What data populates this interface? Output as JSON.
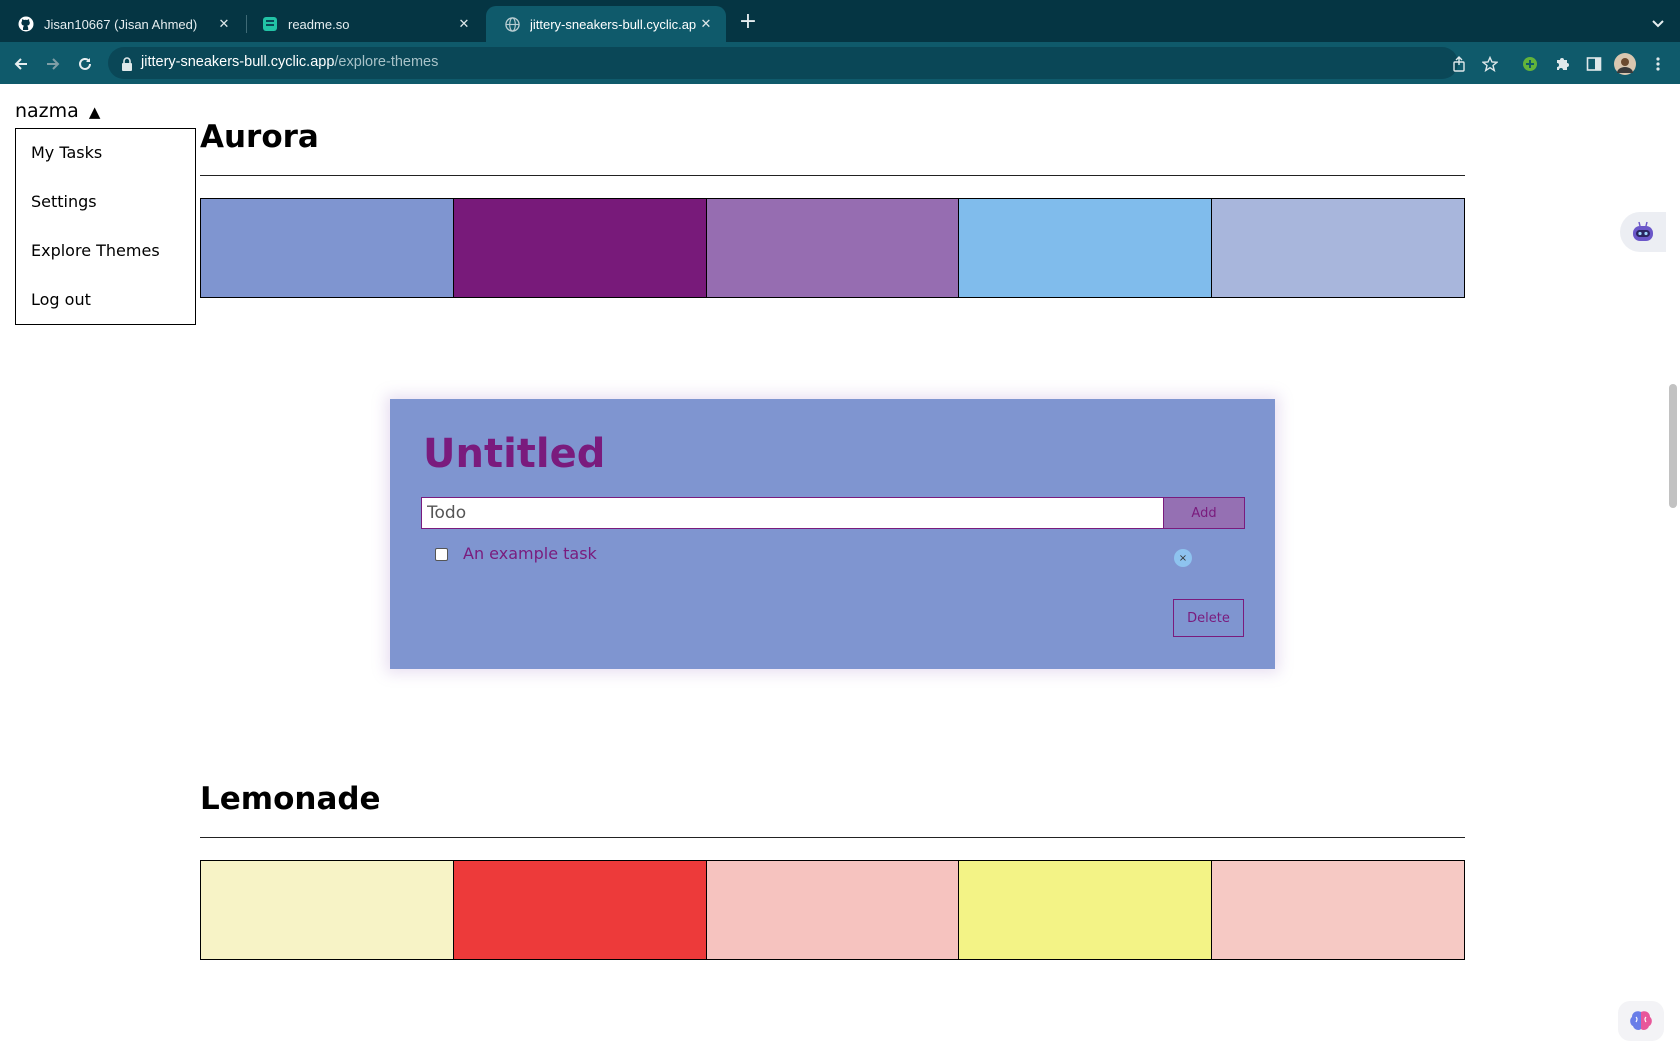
{
  "browser": {
    "tabs": [
      {
        "title": "Jisan10667 (Jisan Ahmed)",
        "icon": "github-icon"
      },
      {
        "title": "readme.so",
        "icon": "readme-so-icon"
      },
      {
        "title": "jittery-sneakers-bull.cyclic.app",
        "icon": "globe-icon"
      }
    ],
    "url_host": "jittery-sneakers-bull.cyclic.app",
    "url_path": "/explore-themes"
  },
  "user": {
    "name": "nazma",
    "caret": "▲",
    "menu": [
      "My Tasks",
      "Settings",
      "Explore Themes",
      "Log out"
    ]
  },
  "themes": [
    {
      "name": "Aurora",
      "colors": [
        "#7f95d0",
        "#781a7a",
        "#966db1",
        "#80bcec",
        "#a8b6dc"
      ]
    },
    {
      "name": "Lemonade",
      "colors": [
        "#f7f3c6",
        "#ed3a3a",
        "#f6c3bf",
        "#f3f386",
        "#f6c9c4"
      ]
    }
  ],
  "preview": {
    "title": "Untitled",
    "input_placeholder": "Todo",
    "add_label": "Add",
    "task_label": "An example task",
    "remove_glyph": "×",
    "delete_label": "Delete",
    "bg_color": "#7f95d0",
    "accent_color": "#7a1b7d"
  }
}
